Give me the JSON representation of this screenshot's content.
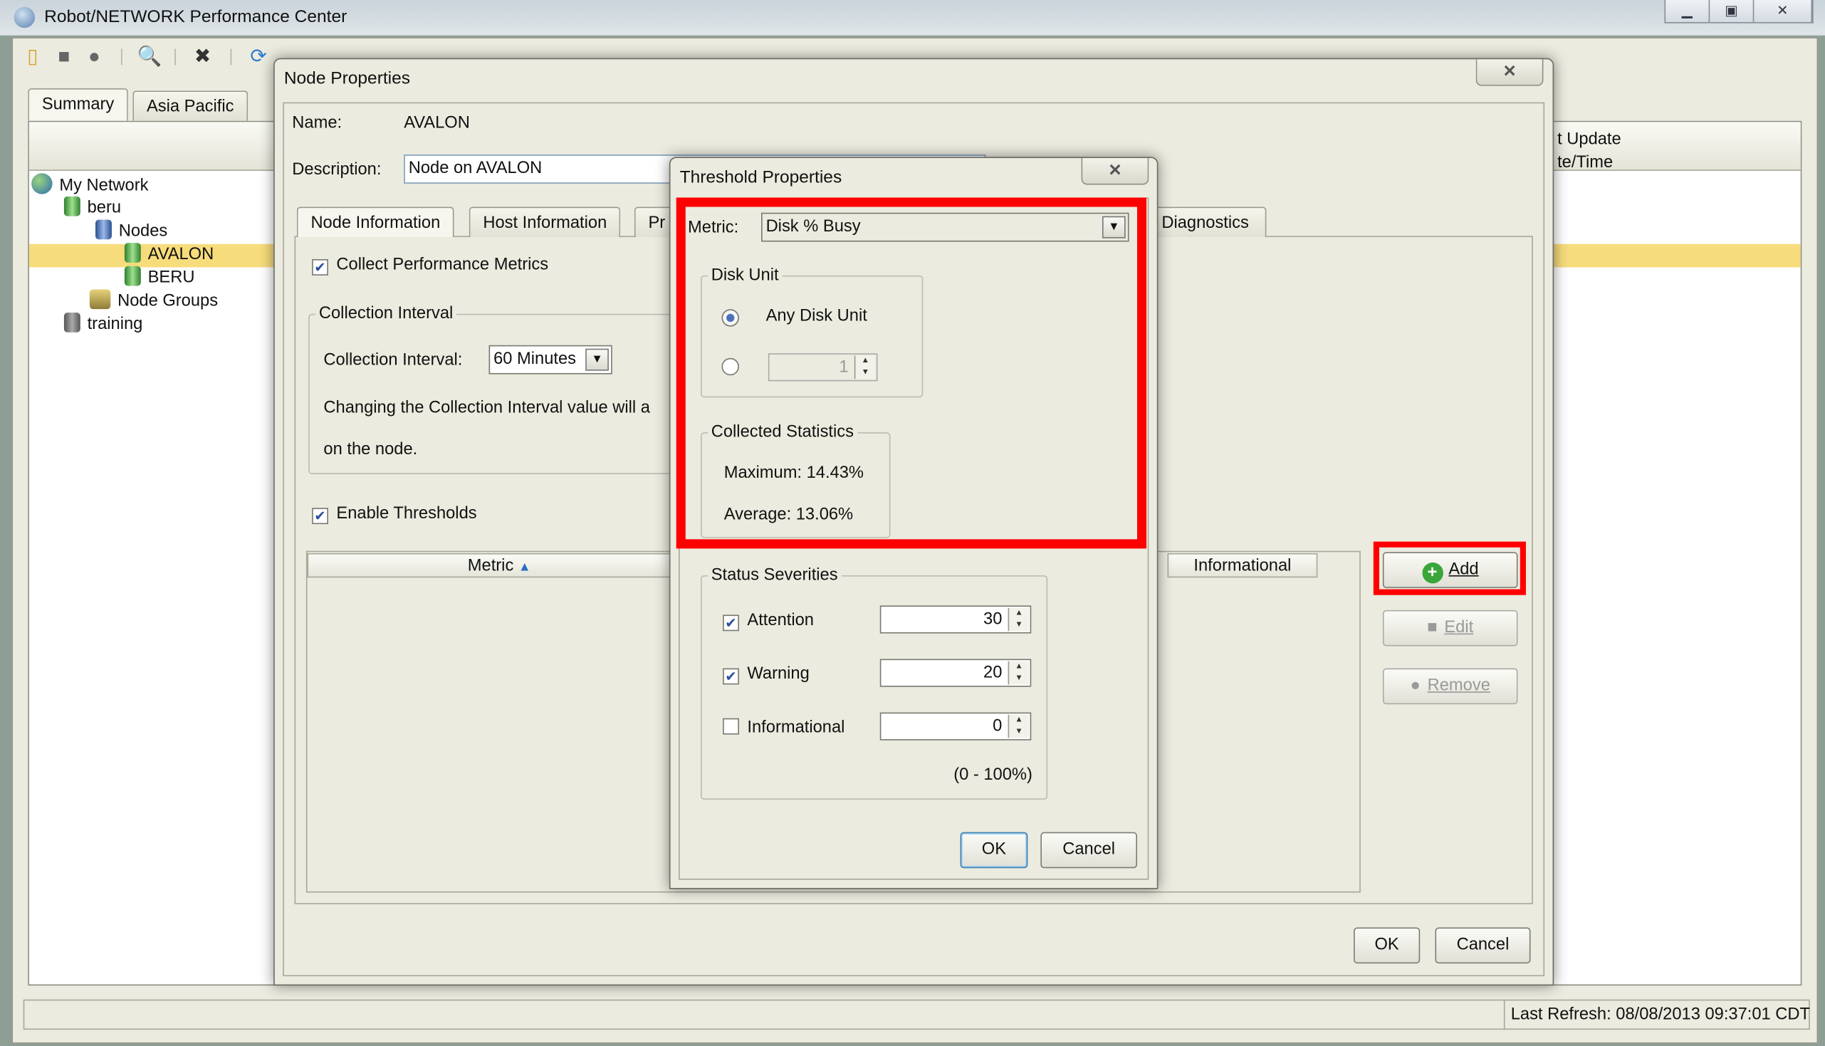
{
  "app": {
    "title": "Robot/NETWORK Performance Center",
    "window_controls": [
      "minimize",
      "restore",
      "close"
    ]
  },
  "toolbar": {
    "icons": [
      "new-icon",
      "edit-icon",
      "delete-icon",
      "view-report-icon",
      "tools-icon",
      "refresh-icon"
    ]
  },
  "main_tabs": [
    {
      "label": "Summary",
      "active": true
    },
    {
      "label": "Asia Pacific",
      "active": false
    }
  ],
  "tree": {
    "items": [
      {
        "label": "My Network",
        "icon": "globe-icon"
      },
      {
        "label": "beru",
        "icon": "server-icon"
      },
      {
        "label": "Nodes",
        "icon": "nodes-icon"
      },
      {
        "label": "AVALON",
        "icon": "node-icon",
        "selected": true
      },
      {
        "label": "BERU",
        "icon": "node-icon"
      },
      {
        "label": "Node Groups",
        "icon": "node-groups-icon"
      },
      {
        "label": "training",
        "icon": "server-icon"
      }
    ]
  },
  "grid": {
    "header_line1": "t Update",
    "header_line2": "te/Time"
  },
  "status_bar": {
    "last_refresh": "Last Refresh: 08/08/2013 09:37:01 CDT"
  },
  "node_dialog": {
    "title": "Node Properties",
    "name_label": "Name:",
    "name_value": "AVALON",
    "description_label": "Description:",
    "description_value": "Node on AVALON",
    "tabs": [
      {
        "label": "Node Information"
      },
      {
        "label": "Host Information"
      },
      {
        "label": "Pr"
      },
      {
        "label": "Diagnostics"
      }
    ],
    "collect_metrics": {
      "label": "Collect Performance Metrics",
      "checked": true
    },
    "collection_group": "Collection Interval",
    "interval_label": "Collection Interval:",
    "interval_value": "60 Minutes",
    "interval_note_1": "Changing the Collection Interval value will a",
    "interval_note_2": "on the node.",
    "enable_thresholds": {
      "label": "Enable Thresholds",
      "checked": true
    },
    "table_headers": {
      "metric": "Metric",
      "metric_sort": "ascending",
      "informational": "Informational"
    },
    "buttons": {
      "add": "Add",
      "edit": "Edit",
      "remove": "Remove",
      "ok": "OK",
      "cancel": "Cancel"
    }
  },
  "threshold_dialog": {
    "title": "Threshold Properties",
    "metric_label": "Metric:",
    "metric_value": "Disk % Busy",
    "disk_unit_group": "Disk Unit",
    "any_disk_unit": "Any Disk Unit",
    "any_disk_selected": true,
    "specific_unit_value": "1",
    "stats_group": "Collected Statistics",
    "maximum": "Maximum: 14.43%",
    "average": "Average: 13.06%",
    "severities_group": "Status Severities",
    "severities": [
      {
        "label": "Attention",
        "checked": true,
        "value": "30"
      },
      {
        "label": "Warning",
        "checked": true,
        "value": "20"
      },
      {
        "label": "Informational",
        "checked": false,
        "value": "0"
      }
    ],
    "range_note": "(0 - 100%)",
    "ok": "OK",
    "cancel": "Cancel"
  },
  "colors": {
    "highlight": "#f7dc7c",
    "annotation": "#ff0000",
    "dialog_bg": "#ecebdf"
  }
}
